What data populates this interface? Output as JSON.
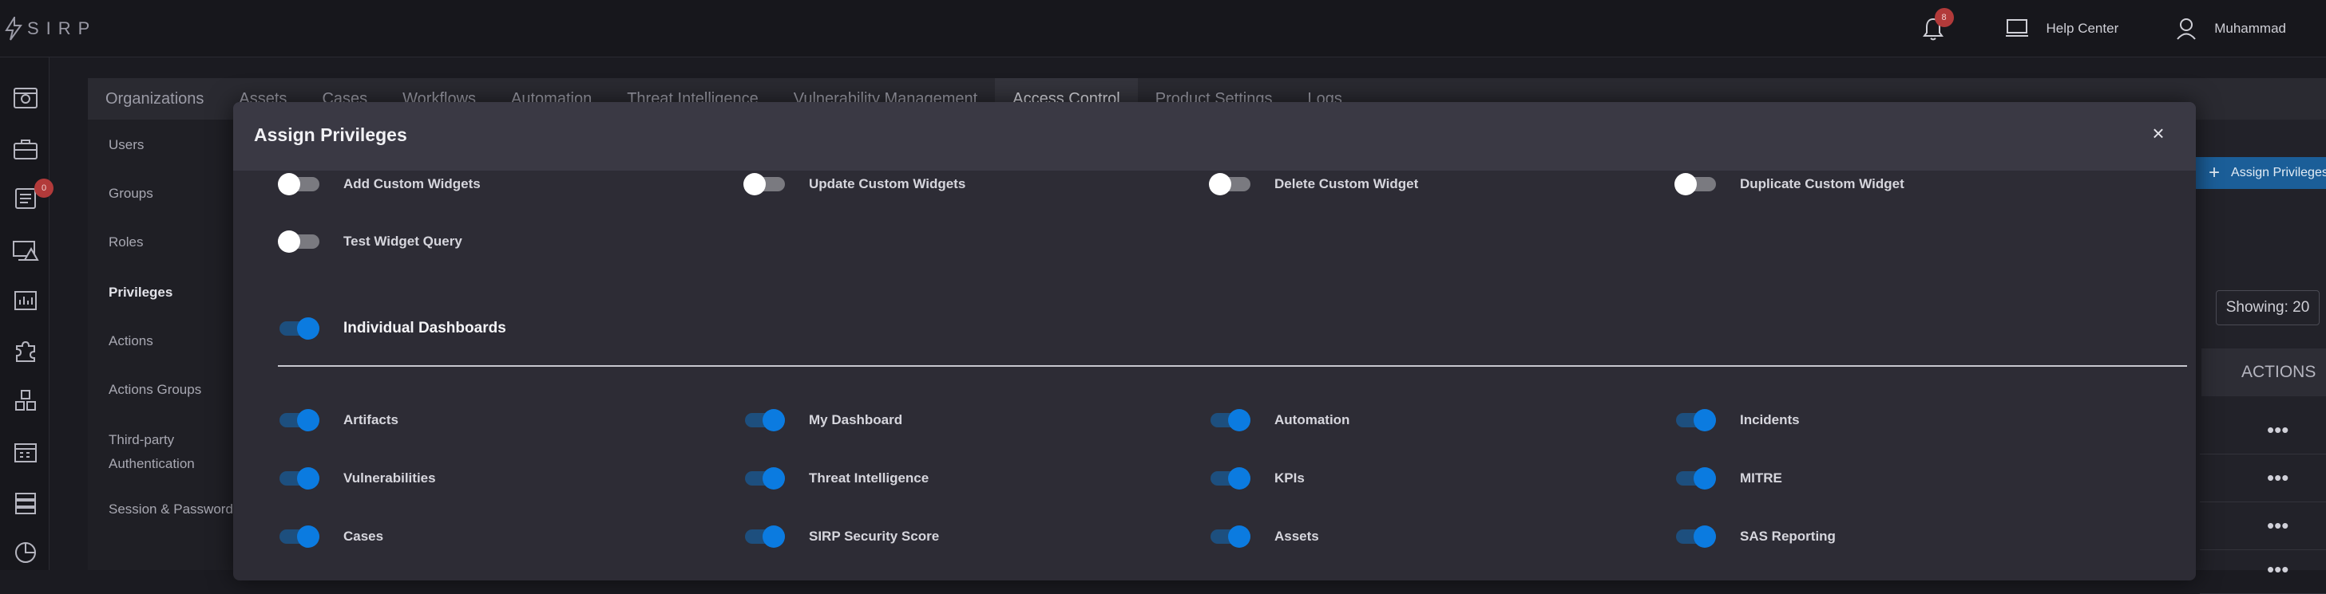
{
  "topbar": {
    "brand": "SIRP",
    "notification_count": "8",
    "help_label": "Help Center",
    "user_name": "Muhammad"
  },
  "leftnav": {
    "icons": [
      "dashboard-icon",
      "briefcase-icon",
      "cases-icon",
      "alert-monitor-icon",
      "analytics-icon",
      "puzzle-icon",
      "cubes-icon",
      "calendar-icon",
      "database-icon",
      "pie-chart-icon"
    ],
    "cases_badge": "0"
  },
  "tabs": [
    {
      "label": "Organizations"
    },
    {
      "label": "Assets"
    },
    {
      "label": "Cases"
    },
    {
      "label": "Workflows"
    },
    {
      "label": "Automation"
    },
    {
      "label": "Threat Intelligence"
    },
    {
      "label": "Vulnerability Management"
    },
    {
      "label": "Access Control",
      "active": true
    },
    {
      "label": "Product Settings"
    },
    {
      "label": "Logs"
    }
  ],
  "subnav": {
    "items": [
      "Users",
      "Groups",
      "Roles",
      "Privileges",
      "Actions",
      "Actions Groups",
      "Third-party Authentication",
      "Session & Password"
    ],
    "active": "Privileges"
  },
  "background": {
    "assign_button": "Assign Privileges",
    "showing": "Showing: 20",
    "actions_header": "ACTIONS",
    "row_menu": "•••"
  },
  "modal": {
    "title": "Assign Privileges",
    "close": "×",
    "widget_privileges": [
      {
        "label": "Add Custom Widgets",
        "enabled": false
      },
      {
        "label": "Update Custom Widgets",
        "enabled": false
      },
      {
        "label": "Delete Custom Widget",
        "enabled": false
      },
      {
        "label": "Duplicate Custom Widget",
        "enabled": false
      },
      {
        "label": "Test Widget Query",
        "enabled": false
      }
    ],
    "group": {
      "label": "Individual Dashboards",
      "enabled": true
    },
    "dashboards": [
      {
        "label": "Artifacts",
        "enabled": true
      },
      {
        "label": "My Dashboard",
        "enabled": true
      },
      {
        "label": "Automation",
        "enabled": true
      },
      {
        "label": "Incidents",
        "enabled": true
      },
      {
        "label": "Vulnerabilities",
        "enabled": true
      },
      {
        "label": "Threat Intelligence",
        "enabled": true
      },
      {
        "label": "KPIs",
        "enabled": true
      },
      {
        "label": "MITRE",
        "enabled": true
      },
      {
        "label": "Cases",
        "enabled": true
      },
      {
        "label": "SIRP Security Score",
        "enabled": true
      },
      {
        "label": "Assets",
        "enabled": true
      },
      {
        "label": "SAS Reporting",
        "enabled": true
      }
    ]
  },
  "colors": {
    "accent": "#0b7be0",
    "toggle_on_track": "#1d4f7e",
    "badge": "#b23a3a",
    "modal_bg": "#2d2c35"
  }
}
